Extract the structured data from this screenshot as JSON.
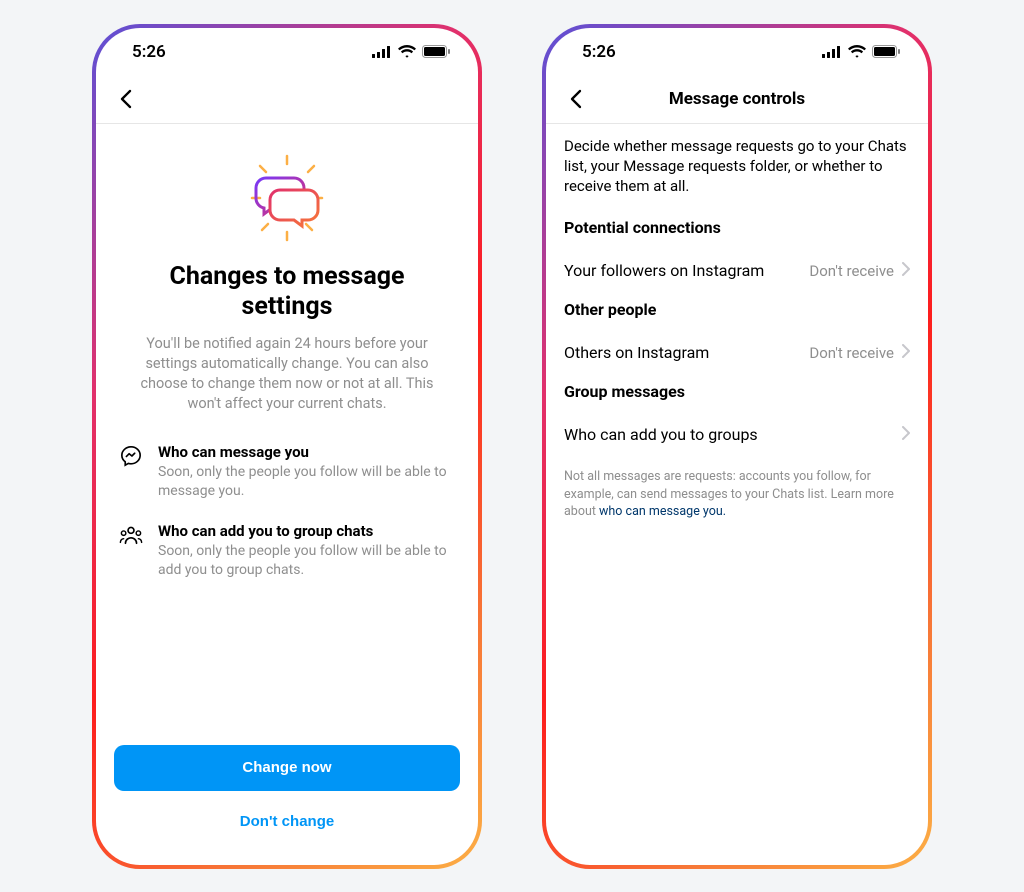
{
  "status_bar": {
    "time": "5:26"
  },
  "screen1": {
    "title": "Changes to message settings",
    "description": "You'll be notified again 24 hours before your settings automatically change. You can also choose to change them now or not at all. This won't affect your current chats.",
    "item1": {
      "title": "Who can message you",
      "sub": "Soon, only the people you follow will be able to message you."
    },
    "item2": {
      "title": "Who can add you to group chats",
      "sub": "Soon, only the people you follow will be able to add you to group chats."
    },
    "primary_button": "Change now",
    "secondary_button": "Don't change"
  },
  "screen2": {
    "nav_title": "Message controls",
    "intro": "Decide whether message requests go to your Chats list, your Message requests folder, or whether to receive them at all.",
    "section_potential": "Potential connections",
    "row_followers": {
      "label": "Your followers on Instagram",
      "value": "Don't receive"
    },
    "section_other": "Other people",
    "row_others": {
      "label": "Others on Instagram",
      "value": "Don't receive"
    },
    "section_group": "Group messages",
    "row_groups": {
      "label": "Who can add you to groups"
    },
    "footnote_text": "Not all messages are requests: accounts you follow, for example, can send messages to your Chats list. Learn more about ",
    "footnote_link": "who can message you."
  }
}
